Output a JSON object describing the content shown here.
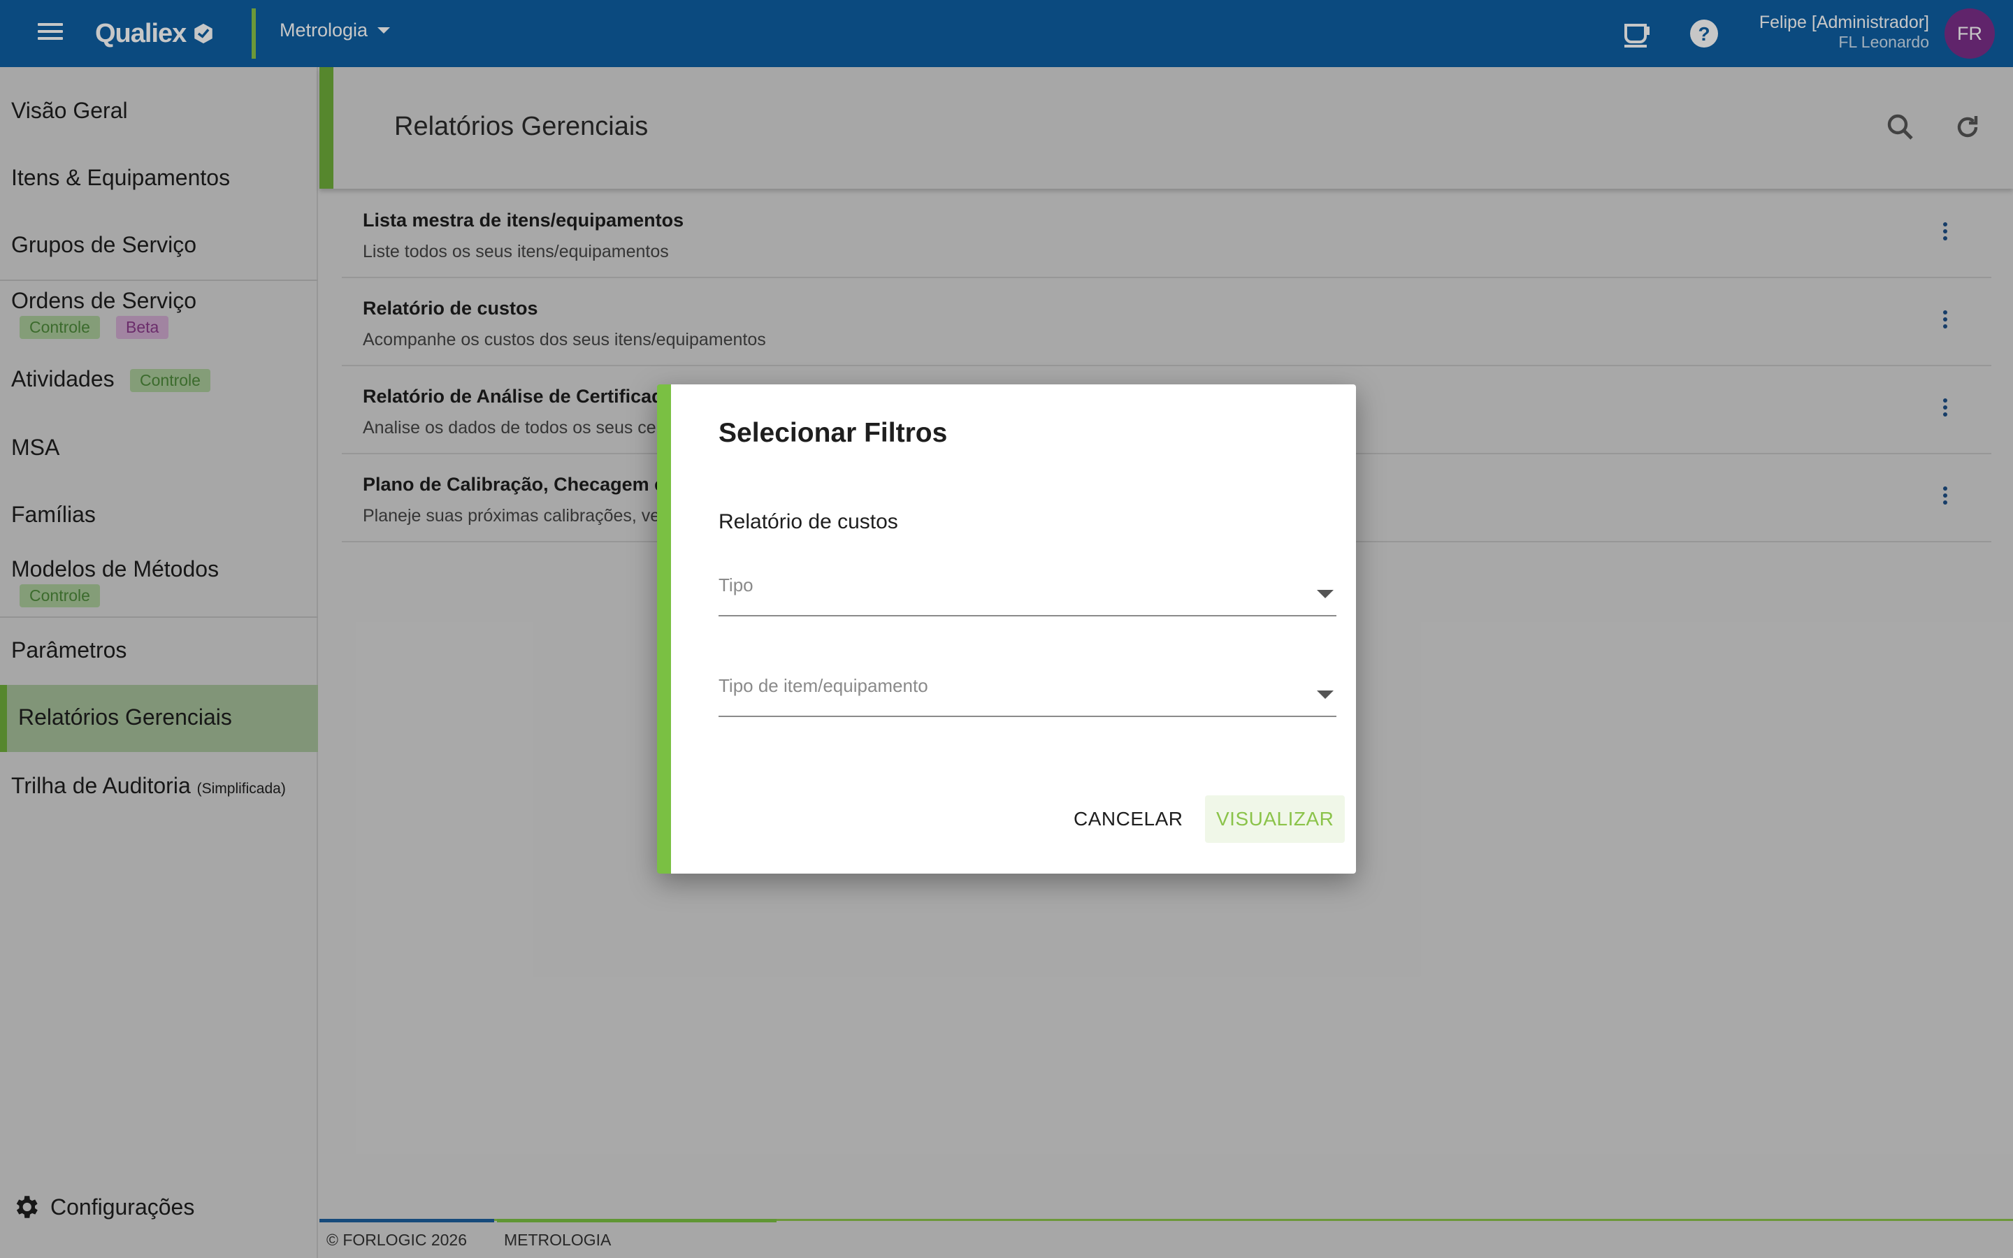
{
  "topbar": {
    "app_name": "Qualiex",
    "module": "Metrologia",
    "user_name": "Felipe [Administrador]",
    "user_org": "FL Leonardo",
    "avatar_initials": "FR",
    "brand_color": "#0f5fa3",
    "accent_color": "#8bc34a"
  },
  "sidebar": {
    "items": [
      {
        "label": "Visão Geral"
      },
      {
        "label": "Itens & Equipamentos"
      },
      {
        "label": "Grupos de Serviço"
      },
      {
        "label": "Ordens de Serviço",
        "badges": [
          "Controle",
          "Beta"
        ]
      },
      {
        "label": "Atividades",
        "badges": [
          "Controle"
        ]
      },
      {
        "label": "MSA"
      },
      {
        "label": "Famílias"
      },
      {
        "label": "Modelos de Métodos",
        "badges": [
          "Controle"
        ]
      },
      {
        "label": "Parâmetros"
      },
      {
        "label": "Relatórios Gerenciais",
        "active": true
      },
      {
        "label": "Trilha de Auditoria",
        "suffix": "(Simplificada)"
      }
    ],
    "settings_label": "Configurações"
  },
  "main": {
    "title": "Relatórios Gerenciais",
    "reports": [
      {
        "title": "Lista mestra de itens/equipamentos",
        "desc": "Liste todos os seus itens/equipamentos"
      },
      {
        "title": "Relatório de custos",
        "desc": "Acompanhe os custos dos seus itens/equipamentos"
      },
      {
        "title": "Relatório de Análise de Certificado",
        "desc": "Analise os dados de todos os seus cert"
      },
      {
        "title": "Plano de Calibração, Checagem e",
        "desc": "Planeje suas próximas calibrações, veri"
      }
    ]
  },
  "footer": {
    "copyright": "© FORLOGIC 2026",
    "module": "METROLOGIA"
  },
  "dialog": {
    "title": "Selecionar Filtros",
    "subtitle": "Relatório de custos",
    "field_tipo": "Tipo",
    "field_tipo_item": "Tipo de item/equipamento",
    "cancel_label": "CANCELAR",
    "view_label": "VISUALIZAR"
  }
}
